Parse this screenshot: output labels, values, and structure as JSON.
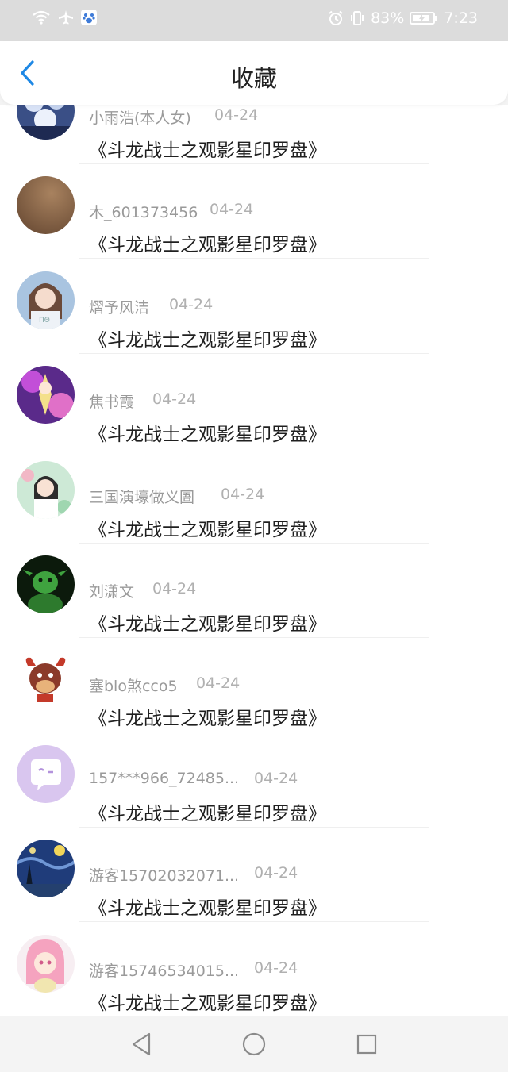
{
  "status_bar": {
    "battery_percent": "83%",
    "time": "7:23",
    "left_icons": [
      "wifi-icon",
      "airplane-icon",
      "baidu-paw-icon"
    ],
    "right_icons": [
      "alarm-icon",
      "vibrate-icon",
      "battery-icon"
    ]
  },
  "header": {
    "title": "收藏",
    "back_icon": "chevron-left-icon",
    "accent": "#1e88e5"
  },
  "list": {
    "items": [
      {
        "user": "小雨浩(本人女)",
        "date": "04-24",
        "title": "《斗龙战士之观影星印罗盘》",
        "avatar": "anime-group-avatar"
      },
      {
        "user": "木_601373456",
        "date": "04-24",
        "title": "《斗龙战士之观影星印罗盘》",
        "avatar": "brown-blur-avatar"
      },
      {
        "user": "熠予风洁",
        "date": "04-24",
        "title": "《斗龙战士之观影星印罗盘》",
        "avatar": "anime-girl-avatar"
      },
      {
        "user": "焦书霞",
        "date": "04-24",
        "title": "《斗龙战士之观影星印罗盘》",
        "avatar": "fairy-avatar"
      },
      {
        "user": "三国演壕做义圄",
        "date": "04-24",
        "title": "《斗龙战士之观影星印罗盘》",
        "avatar": "photo-girl-avatar"
      },
      {
        "user": "刘潇文",
        "date": "04-24",
        "title": "《斗龙战士之观影星印罗盘》",
        "avatar": "green-creature-avatar"
      },
      {
        "user": "塞blo煞cco5",
        "date": "04-24",
        "title": "《斗龙战士之观影星印罗盘》",
        "avatar": "bull-avatar"
      },
      {
        "user": "157***966_72485...",
        "date": "04-24",
        "title": "《斗龙战士之观影星印罗盘》",
        "avatar": "chat-bubble-avatar"
      },
      {
        "user": "游客15702032071...",
        "date": "04-24",
        "title": "《斗龙战士之观影星印罗盘》",
        "avatar": "starry-night-avatar"
      },
      {
        "user": "游客15746534015...",
        "date": "04-24",
        "title": "《斗龙战士之观影星印罗盘》",
        "avatar": "pink-anime-avatar"
      }
    ]
  },
  "nav_bar": {
    "buttons": [
      "back-triangle-icon",
      "home-circle-icon",
      "recents-square-icon"
    ]
  }
}
